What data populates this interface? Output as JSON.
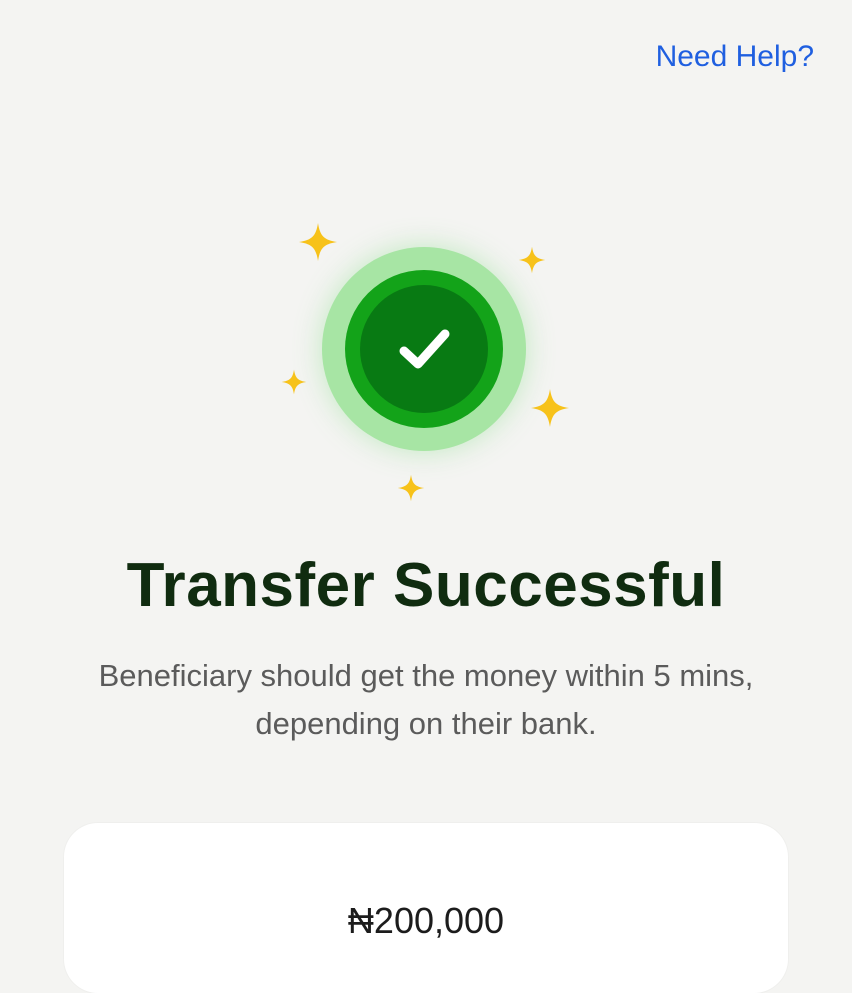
{
  "header": {
    "help_link": "Need Help?"
  },
  "status": {
    "title": "Transfer Successful",
    "message_line_1": "Beneficiary should get the money within 5 mins,",
    "message_line_2": "depending on their bank."
  },
  "summary": {
    "amount": "₦200,000"
  },
  "colors": {
    "link": "#1f5fe0",
    "success_dark": "#087a13",
    "success_mid": "#13a319",
    "success_light": "#a7e5a4",
    "sparkle": "#f7c21a",
    "title": "#102c10",
    "body_text": "#5b5b5b"
  },
  "icons": {
    "status": "check-icon",
    "decoration": "sparkle-icon"
  }
}
